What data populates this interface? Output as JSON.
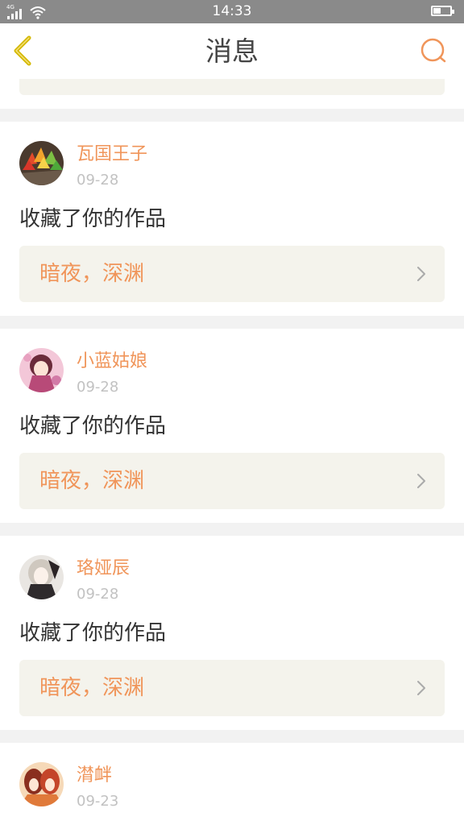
{
  "status_bar": {
    "time": "14:33",
    "network": "4G",
    "signal_icon": "signal-bars-icon",
    "wifi_icon": "wifi-icon",
    "battery_icon": "battery-icon"
  },
  "header": {
    "title": "消息",
    "back_icon": "chevron-left-icon",
    "search_icon": "search-icon",
    "accent_color": "#f0955a"
  },
  "messages": [
    {
      "username": "瓦国王子",
      "date": "09-28",
      "action": "收藏了你的作品",
      "work": "暗夜，深渊"
    },
    {
      "username": "小蓝姑娘",
      "date": "09-28",
      "action": "收藏了你的作品",
      "work": "暗夜，深渊"
    },
    {
      "username": "珞娅辰",
      "date": "09-28",
      "action": "收藏了你的作品",
      "work": "暗夜，深渊"
    },
    {
      "username": "潸衅",
      "date": "09-23"
    }
  ]
}
